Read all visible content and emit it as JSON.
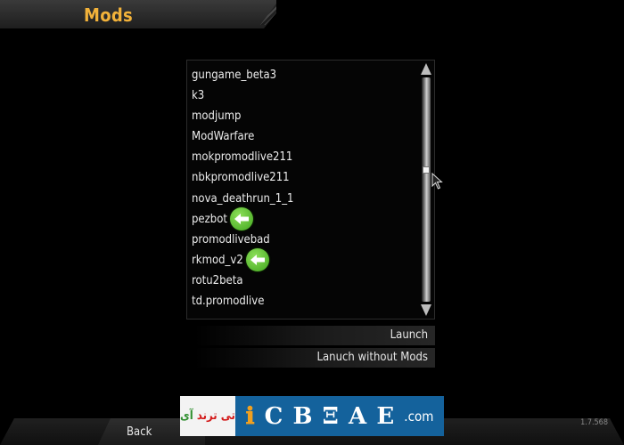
{
  "header": {
    "title": "Mods"
  },
  "mods": [
    {
      "label": "gungame_beta3",
      "marked": false
    },
    {
      "label": "k3",
      "marked": false
    },
    {
      "label": "modjump",
      "marked": false
    },
    {
      "label": "ModWarfare",
      "marked": false
    },
    {
      "label": "mokpromodlive211",
      "marked": false
    },
    {
      "label": "nbkpromodlive211",
      "marked": false
    },
    {
      "label": "nova_deathrun_1_1",
      "marked": false
    },
    {
      "label": "pezbot",
      "marked": true
    },
    {
      "label": "promodlivebad",
      "marked": false
    },
    {
      "label": "rkmod_v2",
      "marked": true
    },
    {
      "label": "rotu2beta",
      "marked": false
    },
    {
      "label": "td.promodlive",
      "marked": false
    }
  ],
  "buttons": {
    "launch": "Launch",
    "launch_without_mods": "Lanuch without Mods",
    "back": "Back"
  },
  "footer": {
    "version": "1.7.568"
  },
  "watermark": {
    "persian_text": "آی تی ترند",
    "domain_text": ".com"
  },
  "icons": {
    "marker": "green-left-arrow-icon",
    "cursor": "mouse-cursor-icon"
  },
  "colors": {
    "title": "#f2b23a",
    "marker": "#4caf23",
    "watermark_blue": "#14629c"
  }
}
